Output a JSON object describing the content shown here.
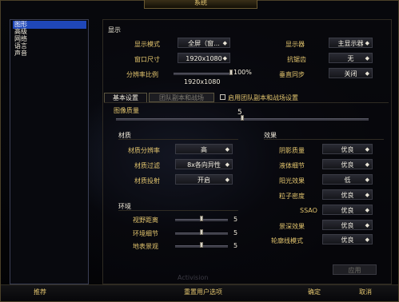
{
  "window": {
    "title": "系统"
  },
  "sidebar": {
    "items": [
      {
        "label": "图形",
        "selected": true
      },
      {
        "label": "高级",
        "selected": false
      },
      {
        "label": "网络",
        "selected": false
      },
      {
        "label": "语言",
        "selected": false
      },
      {
        "label": "声音",
        "selected": false
      }
    ]
  },
  "display": {
    "section_title": "显示",
    "display_mode_label": "显示模式",
    "display_mode_value": "全屏（窗...",
    "monitor_label": "显示器",
    "monitor_value": "主显示器",
    "window_size_label": "窗口尺寸",
    "window_size_value": "1920x1080",
    "antialias_label": "抗锯齿",
    "antialias_value": "无",
    "resolution_scale_label": "分辨率比例",
    "resolution_scale_percent": "100%",
    "resolution_scale_res": "1920x1080",
    "resolution_scale_level": 1.0,
    "vsync_label": "垂直同步",
    "vsync_value": "关闭"
  },
  "tabs": {
    "basic": "基本设置",
    "raid": "团队副本和战场",
    "raid_checkbox_label": "启用团队副本和战场设置",
    "raid_checkbox_checked": false
  },
  "quality": {
    "label": "图像质量",
    "value": "5",
    "level": 0.5
  },
  "texture": {
    "section_title": "材质",
    "resolution_label": "材质分辨率",
    "resolution_value": "高",
    "filter_label": "材质过滤",
    "filter_value": "8x各向异性",
    "projection_label": "材质投射",
    "projection_value": "开启"
  },
  "environment": {
    "section_title": "环境",
    "view_distance_label": "视野距离",
    "view_distance_value": "5",
    "view_distance_level": 0.5,
    "env_detail_label": "环境细节",
    "env_detail_value": "5",
    "env_detail_level": 0.5,
    "ground_label": "地表景观",
    "ground_value": "5",
    "ground_level": 0.5
  },
  "effects": {
    "section_title": "效果",
    "shadow_label": "阴影质量",
    "shadow_value": "优良",
    "liquid_label": "液体细节",
    "liquid_value": "优良",
    "sunshafts_label": "阳光效果",
    "sunshafts_value": "低",
    "particle_label": "粒子密度",
    "particle_value": "优良",
    "ssao_label": "SSAO",
    "ssao_value": "优良",
    "depth_label": "景深效果",
    "depth_value": "优良",
    "outline_label": "轮廓线模式",
    "outline_value": "优良"
  },
  "buttons": {
    "apply": "应用",
    "recommended": "推荐",
    "reset": "重置用户选项",
    "ok": "确定",
    "cancel": "取消"
  },
  "watermark": "Activision"
}
